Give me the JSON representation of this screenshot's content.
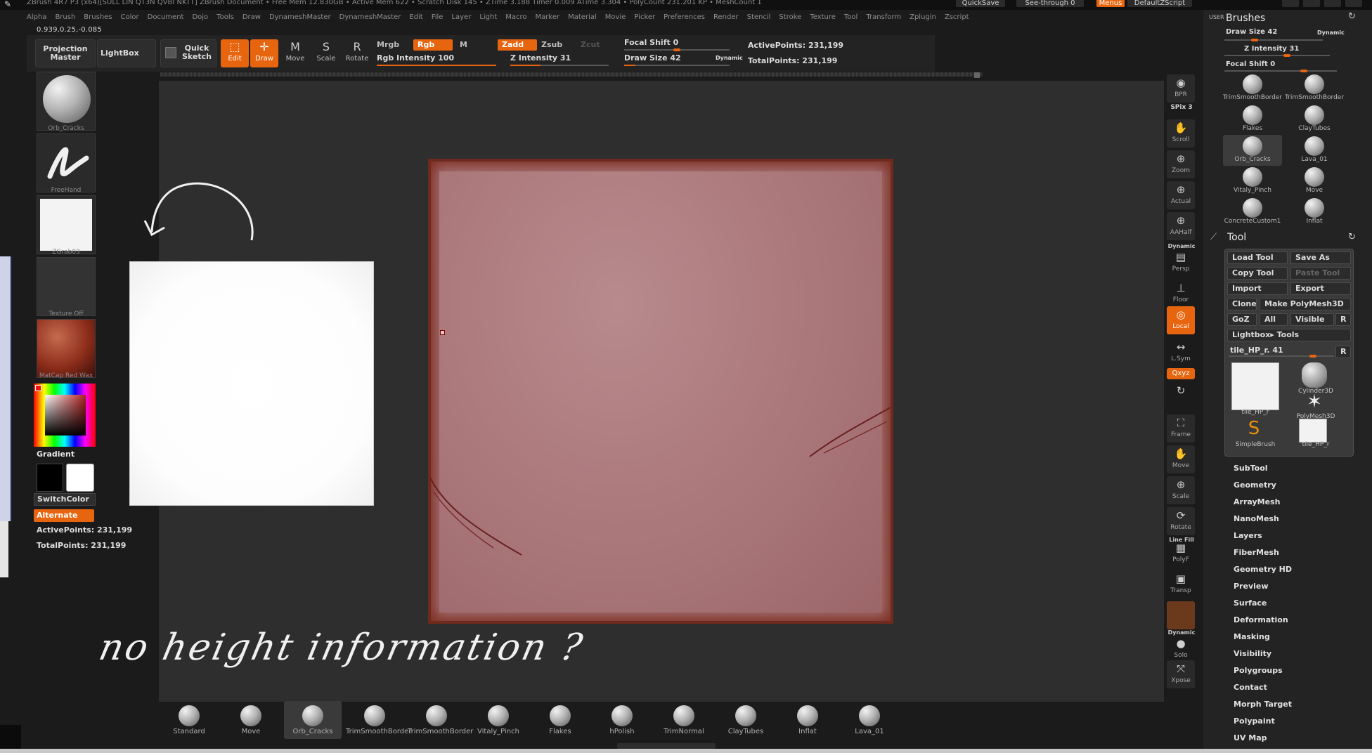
{
  "titlebar": {
    "text": "ZBrush 4R7 P3 (x64)[SULL LIN QT3N QVBI NKTT]   ZBrush Document   • Free Mem 12.830GB • Active Mem 622 • Scratch Disk 145 • ZTime 3.188 Timer 0.009 ATime 3.304 • PolyCount 231.201 KP • MeshCount 1",
    "quicksave": "QuickSave",
    "seethrough": "See-through  0",
    "menus": "Menus",
    "script": "DefaultZScript"
  },
  "menubar": [
    "Alpha",
    "Brush",
    "Brushes",
    "Color",
    "Document",
    "Dojo",
    "Tools",
    "Draw",
    "DynameshMaster",
    "DynameshMaster",
    "Edit",
    "File",
    "Layer",
    "Light",
    "Macro",
    "Marker",
    "Material",
    "Movie",
    "Picker",
    "Preferences",
    "Render",
    "Stencil",
    "Stroke",
    "Texture",
    "Tool",
    "Transform",
    "Zplugin",
    "Zscript"
  ],
  "coords": "0.939,0.25,-0.085",
  "left_panel": {
    "brush_label": "Orb_Cracks",
    "stroke_label": "FreeHand",
    "alpha_label": "ZGrab03",
    "texture_label": "Texture Off",
    "material_label": "MatCap Red Wax",
    "gradient": "Gradient",
    "switch_color": "SwitchColor",
    "alternate": "Alternate",
    "active_points": "ActivePoints: 231,199",
    "total_points": "TotalPoints: 231,199"
  },
  "toolbar": {
    "projection_master": "Projection Master",
    "lightbox": "LightBox",
    "quick_sketch": "Quick Sketch",
    "edit": "Edit",
    "draw": "Draw",
    "move": "Move",
    "scale": "Scale",
    "rotate": "Rotate",
    "mrgb": "Mrgb",
    "rgb": "Rgb",
    "m": "M",
    "zadd": "Zadd",
    "zsub": "Zsub",
    "zcut": "Zcut",
    "rgb_intensity": "Rgb  Intensity 100",
    "z_intensity": "Z Intensity 31",
    "focal_shift": "Focal Shift 0",
    "draw_size": "Draw Size 42",
    "dynamic": "Dynamic",
    "active_points": "ActivePoints: 231,199",
    "total_points": "TotalPoints: 231,199",
    "rgb_intensity_value": 100,
    "z_intensity_value": 31,
    "focal_shift_value": 0,
    "draw_size_value": 42
  },
  "annotation": "no height information ?",
  "right_shelf": {
    "bpr": "BPR",
    "spix": "SPix 3",
    "scroll": "Scroll",
    "zoom": "Zoom",
    "actual": "Actual",
    "aahalf": "AAHalf",
    "dynamic": "Dynamic",
    "persp": "Persp",
    "floor": "Floor",
    "local": "Local",
    "lsym": "L.Sym",
    "xyz": "Qxyz",
    "frame": "Frame",
    "move": "Move",
    "scale": "Scale",
    "rotate": "Rotate",
    "linefill": "Line Fill",
    "polyf": "PolyF",
    "transp": "Transp",
    "dynamic2": "Dynamic",
    "solo": "Solo",
    "xpose": "Xpose"
  },
  "bottom_shelf": [
    "Standard",
    "Move",
    "Orb_Cracks",
    "TrimSmoothBorder",
    "TrimSmoothBorder",
    "Vitaly_Pinch",
    "Flakes",
    "hPolish",
    "TrimNormal",
    "ClayTubes",
    "Inflat",
    "Lava_01"
  ],
  "right_panel": {
    "user": "USER",
    "brushes_title": "Brushes",
    "draw_size": "Draw Size 42",
    "dynamic": "Dynamic",
    "z_intensity": "Z Intensity 31",
    "focal_shift": "Focal Shift 0",
    "brushes": [
      "TrimSmoothBorder",
      "TrimSmoothBorder",
      "Flakes",
      "ClayTubes",
      "Orb_Cracks",
      "Lava_01",
      "Vitaly_Pinch",
      "Move",
      "ConcreteCustom1",
      "Inflat"
    ],
    "tool_title": "Tool",
    "load_tool": "Load Tool",
    "save_as": "Save As",
    "copy_tool": "Copy Tool",
    "paste_tool": "Paste Tool",
    "import": "Import",
    "export": "Export",
    "clone": "Clone",
    "make_polymesh": "Make PolyMesh3D",
    "goz": "GoZ",
    "all": "All",
    "visible": "Visible",
    "r": "R",
    "lightbox_tools": "Lightbox▸ Tools",
    "current_tool": "tile_HP_r. 41",
    "current_tool_value": 41,
    "tools": [
      "tile_HP_r",
      "Cylinder3D",
      "PolyMesh3D",
      "SimpleBrush",
      "tile_HP_r"
    ],
    "menu": [
      "SubTool",
      "Geometry",
      "ArrayMesh",
      "NanoMesh",
      "Layers",
      "FiberMesh",
      "Geometry HD",
      "Preview",
      "Surface",
      "Deformation",
      "Masking",
      "Visibility",
      "Polygroups",
      "Contact",
      "Morph Target",
      "Polypaint",
      "UV Map"
    ]
  },
  "colors": {
    "accent": "#e8650f",
    "tile": "#a56f72",
    "tile_border": "#6e2a1d"
  }
}
